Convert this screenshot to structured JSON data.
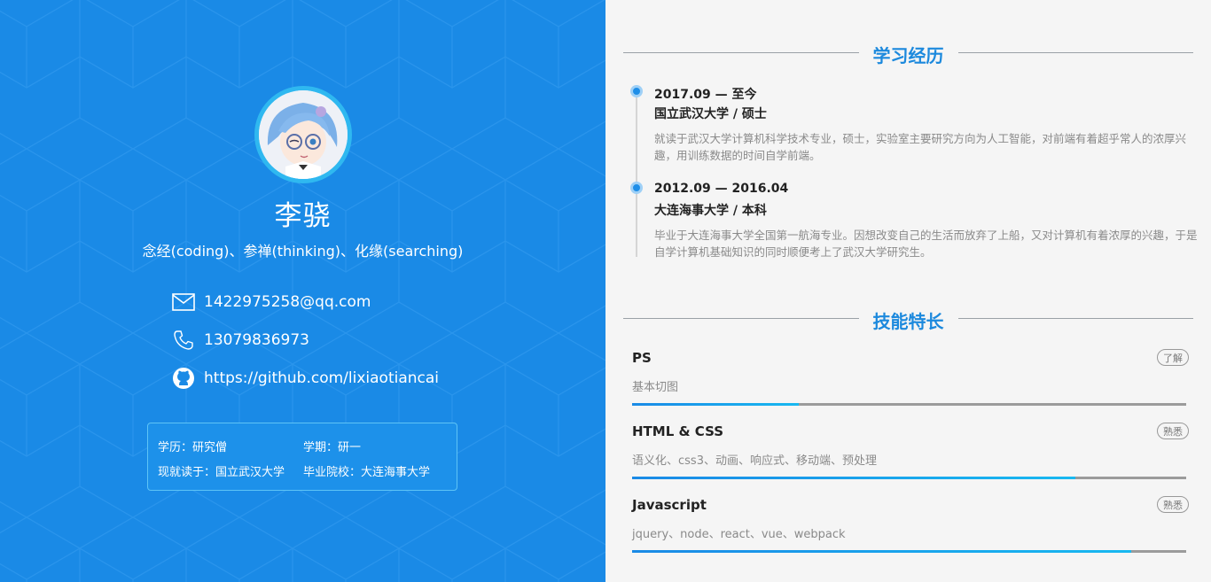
{
  "profile": {
    "name": "李骁",
    "motto": "念经(coding)、参禅(thinking)、化缘(searching)",
    "email": "1422975258@qq.com",
    "phone": "13079836973",
    "github": "https://github.com/lixiaotiancai",
    "info": {
      "degree": "学历：研究僧",
      "term": "学期：研一",
      "current_school": "现就读于：国立武汉大学",
      "graduated_from": "毕业院校：大连海事大学"
    }
  },
  "education": {
    "title": "学习经历",
    "items": [
      {
        "date": "2017.09 — 至今",
        "school": "国立武汉大学 / 硕士",
        "desc": "就读于武汉大学计算机科学技术专业，硕士，实验室主要研究方向为人工智能，对前端有着超乎常人的浓厚兴趣，用训练数据的时间自学前端。"
      },
      {
        "date": "2012.09 — 2016.04",
        "school": "大连海事大学 / 本科",
        "desc": "毕业于大连海事大学全国第一航海专业。因想改变自己的生活而放弃了上船，又对计算机有着浓厚的兴趣，于是自学计算机基础知识的同时顺便考上了武汉大学研究生。"
      }
    ]
  },
  "skills": {
    "title": "技能特长",
    "items": [
      {
        "name": "PS",
        "desc": "基本切图",
        "level_label": "了解",
        "level": 0.3
      },
      {
        "name": "HTML & CSS",
        "desc": "语义化、css3、动画、响应式、移动端、预处理",
        "level_label": "熟悉",
        "level": 0.8
      },
      {
        "name": "Javascript",
        "desc": "jquery、node、react、vue、webpack",
        "level_label": "熟悉",
        "level": 0.9
      }
    ]
  },
  "colors": {
    "left_bg": "#1a8ae6",
    "accent": "#1c89dd",
    "bar_track": "#9b9b9b"
  },
  "icons": {
    "email": "mail-icon",
    "phone": "phone-icon",
    "github": "github-icon"
  }
}
